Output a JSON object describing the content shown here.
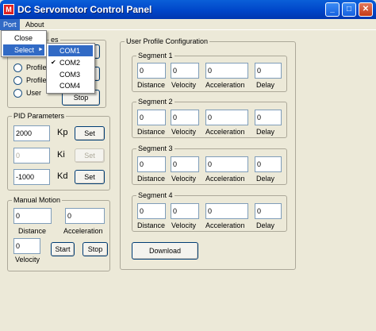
{
  "window": {
    "title": "DC Servomotor Control Panel",
    "controls": {
      "minimize": "_",
      "maximize": "□",
      "close": "✕"
    }
  },
  "menubar": {
    "items": [
      {
        "label": "Port"
      },
      {
        "label": "About"
      }
    ]
  },
  "port_menu": {
    "items": [
      {
        "label": "Close"
      },
      {
        "label": "Select"
      }
    ],
    "submenu_arrow": "►"
  },
  "com_submenu": {
    "items": [
      {
        "label": "COM1",
        "highlighted": true
      },
      {
        "label": "COM2",
        "checked": true
      },
      {
        "label": "COM3"
      },
      {
        "label": "COM4"
      }
    ],
    "check_glyph": "✔"
  },
  "profile_group": {
    "title_visible_fragment": "es",
    "radios": [
      {
        "label": "Profile"
      },
      {
        "label": "Profile"
      },
      {
        "label": "User"
      }
    ],
    "stop_label": "Stop"
  },
  "pid": {
    "title": "PID Parameters",
    "rows": [
      {
        "value": "2000",
        "label": "Kp",
        "button": "Set",
        "enabled": true
      },
      {
        "value": "0",
        "label": "Ki",
        "button": "Set",
        "enabled": false
      },
      {
        "value": "-1000",
        "label": "Kd",
        "button": "Set",
        "enabled": true
      }
    ]
  },
  "manual": {
    "title": "Manual Motion",
    "distance_value": "0",
    "acceleration_value": "0",
    "velocity_value": "0",
    "distance_label": "Distance",
    "acceleration_label": "Acceleration",
    "velocity_label": "Velocity",
    "start_label": "Start",
    "stop_label": "Stop"
  },
  "user_profile": {
    "title": "User Profile Configuration",
    "segments": [
      {
        "title": "Segment 1",
        "values": [
          "0",
          "0",
          "0",
          "0"
        ]
      },
      {
        "title": "Segment 2",
        "values": [
          "0",
          "0",
          "0",
          "0"
        ]
      },
      {
        "title": "Segment 3",
        "values": [
          "0",
          "0",
          "0",
          "0"
        ]
      },
      {
        "title": "Segment 4",
        "values": [
          "0",
          "0",
          "0",
          "0"
        ]
      }
    ],
    "field_labels": [
      "Distance",
      "Velocity",
      "Acceleration",
      "Delay"
    ],
    "download_label": "Download"
  }
}
